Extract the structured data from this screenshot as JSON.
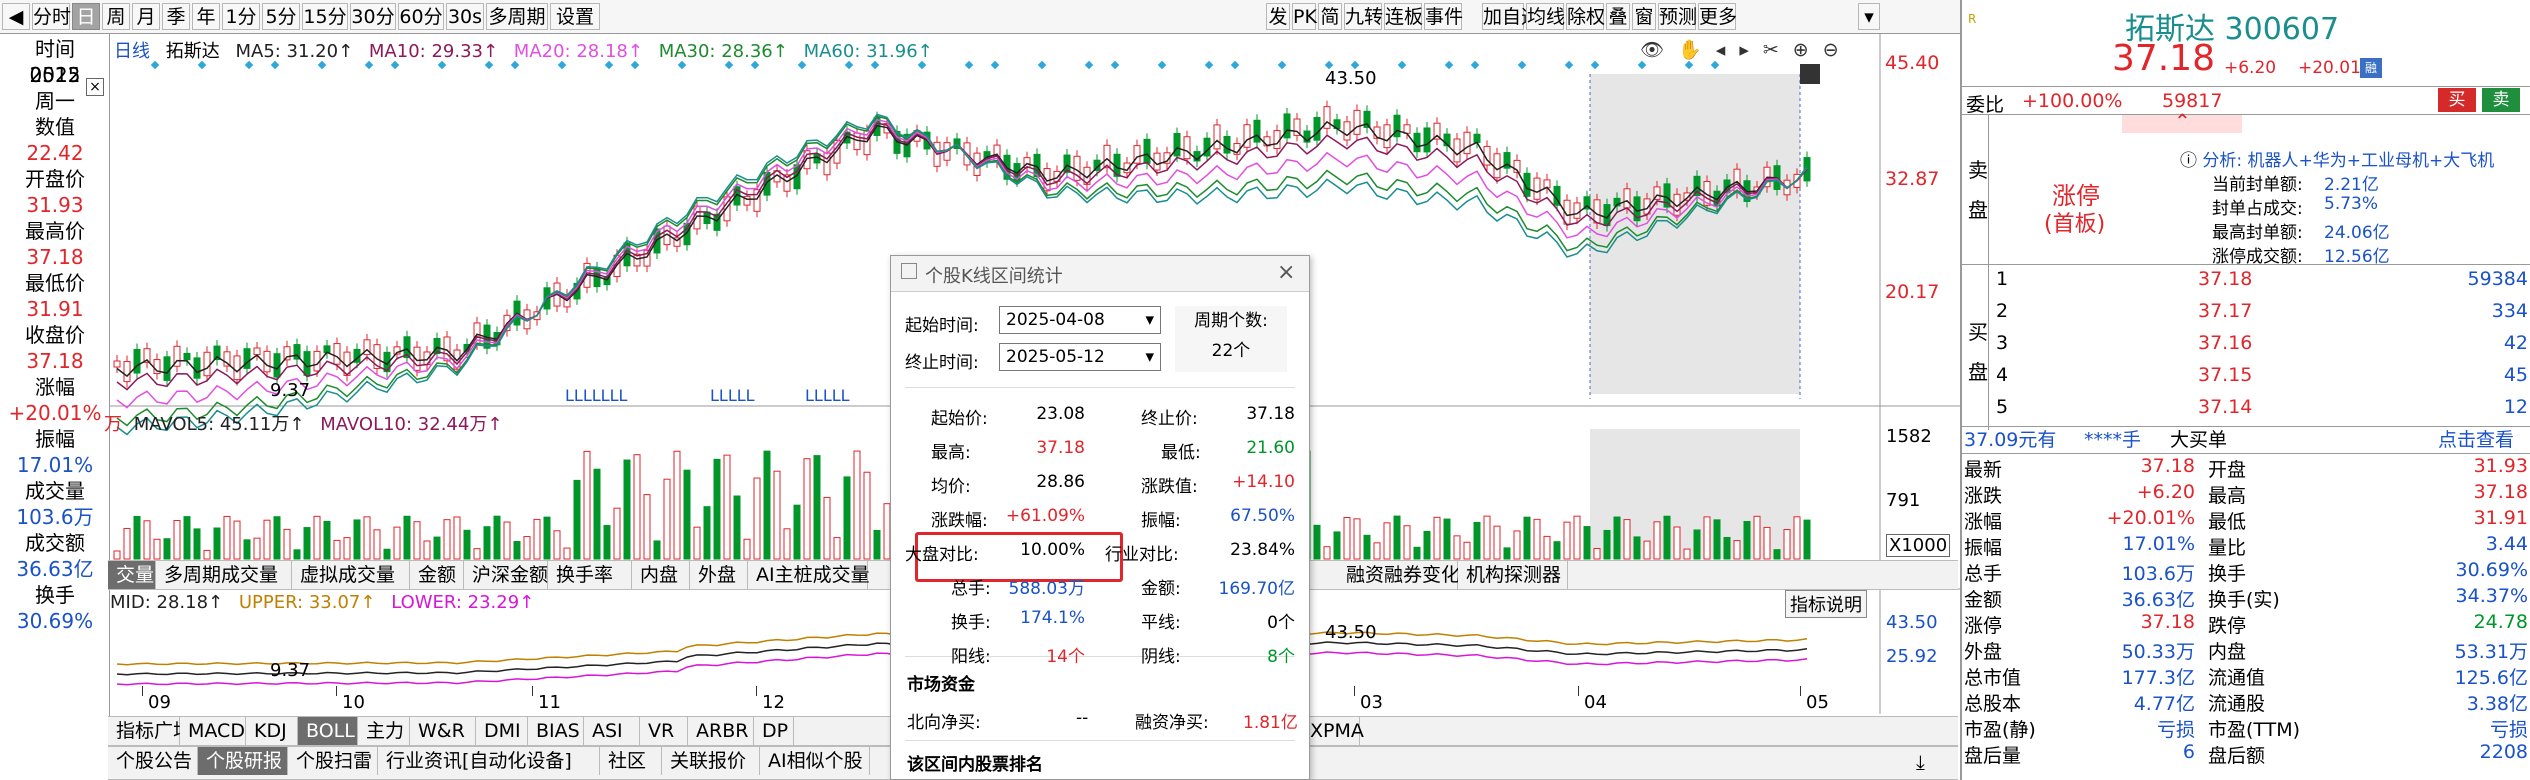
{
  "toolbar": {
    "left": [
      "分时",
      "日",
      "周",
      "月",
      "季",
      "年",
      "1分",
      "5分",
      "15分",
      "30分",
      "60分",
      "30s",
      "多周期",
      "设置"
    ],
    "right": [
      "发",
      "PK",
      "简",
      "九转",
      "连板",
      "事件",
      "加自选",
      "均线",
      "除权",
      "叠",
      "窗",
      "预测",
      "更多"
    ]
  },
  "indicators": {
    "line": "日线",
    "name": "拓斯达",
    "ma5": "MA5: 31.20↑",
    "ma10": "MA10: 29.33↑",
    "ma20": "MA20: 28.18↑",
    "ma30": "MA30: 28.36↑",
    "ma60": "MA60: 31.96↑"
  },
  "price_axis": [
    "45.40",
    "32.87",
    "20.17"
  ],
  "chart_labels": {
    "high": "43.50",
    "low": "9.37",
    "l1": "LLLLLLL",
    "l2": "LLLLL",
    "l3": "LLLLL"
  },
  "vol_legend": {
    "unit": "万",
    "mavol5": "MAVOL5: 45.11万↑",
    "mavol10": "MAVOL10: 32.44万↑",
    "axis_hi": "1582",
    "axis_mid": "791",
    "axis_x": "X1000"
  },
  "vol_tabs": [
    "交量",
    "多周期成交量",
    "虚拟成交量",
    "金额",
    "沪深金额",
    "换手率",
    "内盘",
    "外盘",
    "AI主桩成交量",
    "融资融券变化",
    "机构探测器"
  ],
  "boll_legend": {
    "mid": "MID: 28.18↑",
    "upper": "UPPER: 33.07↑",
    "lower": "LOWER: 23.29↑",
    "axis_hi": "43.50",
    "axis_lo": "25.92",
    "hint": "指标说明",
    "low": "9.37",
    "high": "43.50"
  },
  "months": [
    "09",
    "10",
    "11",
    "12",
    "03",
    "04",
    "05"
  ],
  "indicator_tabs": [
    "指标广场",
    "MACD",
    "KDJ",
    "BOLL",
    "主力",
    "W&R",
    "DMI",
    "BIAS",
    "ASI",
    "VR",
    "ARBR",
    "DP",
    "EXPMA"
  ],
  "bottom_tabs": [
    "个股公告",
    "个股研报",
    "个股扫雷",
    "行业资讯[自动化设备]",
    "社区",
    "关联报价",
    "AI相似个股"
  ],
  "left_panel": [
    {
      "k": "时间",
      "v": "2025"
    },
    {
      "k": "",
      "v": "0512"
    },
    {
      "k": "",
      "v": "周一"
    },
    {
      "k": "数值",
      "v": "22.42",
      "c": "red"
    },
    {
      "k": "开盘价",
      "v": "31.93",
      "c": "red"
    },
    {
      "k": "最高价",
      "v": "37.18",
      "c": "red"
    },
    {
      "k": "最低价",
      "v": "31.91",
      "c": "red"
    },
    {
      "k": "收盘价",
      "v": "37.18",
      "c": "red"
    },
    {
      "k": "涨幅",
      "v": "+20.01%",
      "c": "red"
    },
    {
      "k": "振幅",
      "v": "17.01%",
      "c": "blue"
    },
    {
      "k": "成交量",
      "v": "103.6万",
      "c": "blue"
    },
    {
      "k": "成交额",
      "v": "36.63亿",
      "c": "blue"
    },
    {
      "k": "换手",
      "v": "30.69%",
      "c": "blue"
    }
  ],
  "popup": {
    "title": "个股K线区间统计",
    "start_label": "起始时间:",
    "start": "2025-04-08",
    "end_label": "终止时间:",
    "end": "2025-05-12",
    "count_label": "周期个数:",
    "count": "22个",
    "rows": [
      [
        "起始价:",
        "23.08",
        "终止价:",
        "37.18"
      ],
      [
        "最高:",
        "37.18",
        "最低:",
        "21.60"
      ],
      [
        "均价:",
        "28.86",
        "涨跌值:",
        "+14.10"
      ],
      [
        "涨跌幅:",
        "+61.09%",
        "振幅:",
        "67.50%"
      ],
      [
        "大盘对比:",
        "10.00%",
        "行业对比:",
        "23.84%"
      ],
      [
        "总手:",
        "588.03万",
        "金额:",
        "169.70亿"
      ],
      [
        "换手:",
        "174.1%",
        "平线:",
        "0个"
      ],
      [
        "阳线:",
        "14个",
        "阴线:",
        "8个"
      ]
    ],
    "fund_title": "市场资金",
    "north_label": "北向净买:",
    "north": "--",
    "margin_label": "融资净买:",
    "margin": "1.81亿",
    "rank_title": "该区间内股票排名"
  },
  "quote": {
    "name": "拓斯达",
    "code": "300607",
    "price": "37.18",
    "chg": "+6.20",
    "pct": "+20.01%",
    "wb_label": "委比",
    "wb": "+100.00%",
    "wb_vol": "59817",
    "buy": "买",
    "sell": "卖",
    "limit": "涨停",
    "limit_sub": "(首板)",
    "analysis": "分析: 机器人+华为+工业母机+大飞机",
    "seal": [
      [
        "当前封单额:",
        "2.21亿"
      ],
      [
        "封单占成交:",
        "5.73%"
      ],
      [
        "最高封单额:",
        "24.06亿"
      ],
      [
        "涨停成交额:",
        "12.56亿"
      ]
    ],
    "sell_side": "卖盘",
    "buy_side": "买盘",
    "bids": [
      [
        "1",
        "37.18",
        "59384"
      ],
      [
        "2",
        "37.17",
        "334"
      ],
      [
        "3",
        "37.16",
        "42"
      ],
      [
        "4",
        "37.15",
        "45"
      ],
      [
        "5",
        "37.14",
        "12"
      ]
    ],
    "flow": [
      "37.09元有",
      "****手",
      "大买单",
      "点击查看"
    ],
    "stats": [
      [
        "最新",
        "37.18",
        "开盘",
        "31.93"
      ],
      [
        "涨跌",
        "+6.20",
        "最高",
        "37.18"
      ],
      [
        "涨幅",
        "+20.01%",
        "最低",
        "31.91"
      ],
      [
        "振幅",
        "17.01%",
        "量比",
        "3.44"
      ],
      [
        "总手",
        "103.6万",
        "换手",
        "30.69%"
      ],
      [
        "金额",
        "36.63亿",
        "换手(实)",
        "34.37%"
      ],
      [
        "涨停",
        "37.18",
        "跌停",
        "24.78"
      ],
      [
        "外盘",
        "50.33万",
        "内盘",
        "53.31万"
      ],
      [
        "总市值",
        "177.3亿",
        "流通值",
        "125.6亿"
      ],
      [
        "总股本",
        "4.77亿",
        "流通股",
        "3.38亿"
      ],
      [
        "市盈(静)",
        "亏损",
        "市盈(TTM)",
        "亏损"
      ],
      [
        "盘后量",
        "6",
        "盘后额",
        "2208"
      ]
    ]
  },
  "colors": {
    "up": "#e0262b",
    "down": "#00962a",
    "ma5": "#222222",
    "ma10": "#8b1a5a",
    "ma20": "#e050e0",
    "ma30": "#1e8b2e",
    "ma60": "#1a8e8e"
  }
}
